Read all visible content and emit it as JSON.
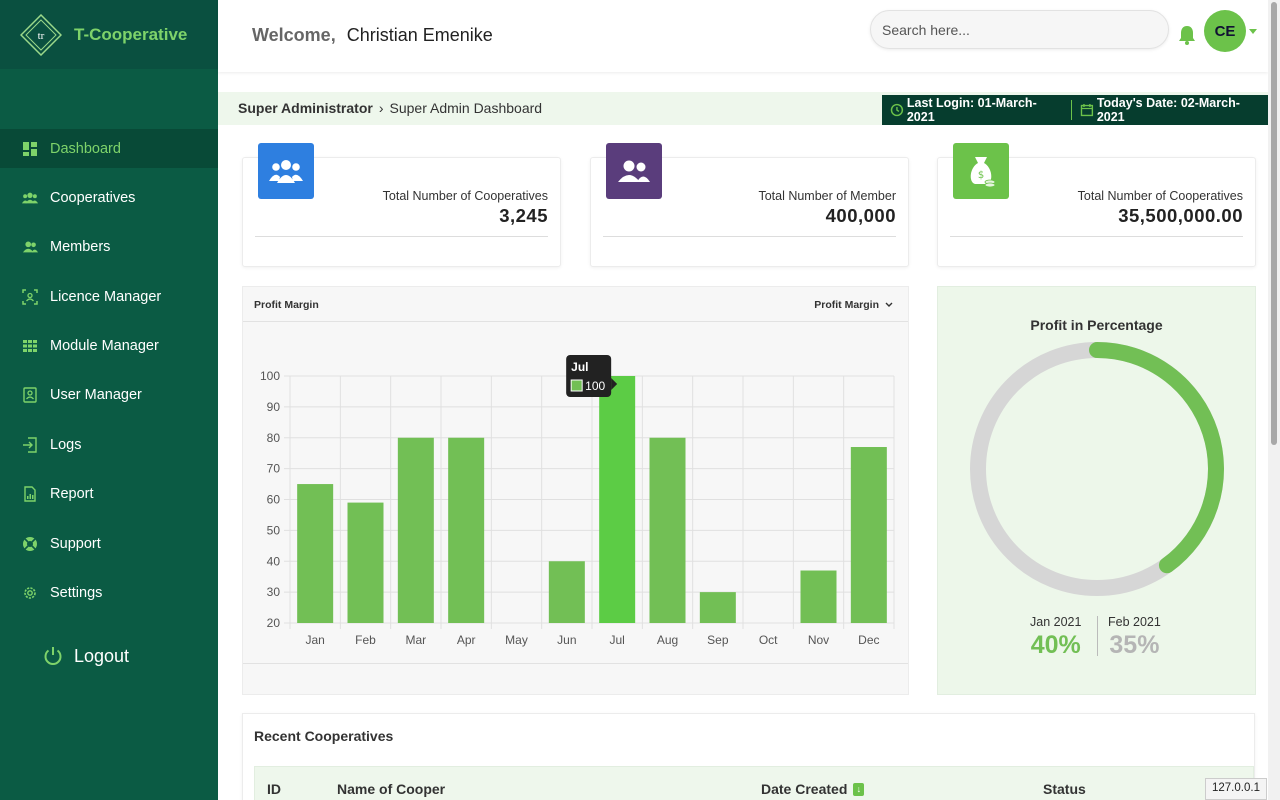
{
  "brand": {
    "name": "T-Cooperative",
    "logo_text": "tr"
  },
  "sidebar": {
    "items": [
      {
        "label": "Dashboard",
        "icon": "dashboard-icon",
        "active": true
      },
      {
        "label": "Cooperatives",
        "icon": "users-group-icon"
      },
      {
        "label": "Members",
        "icon": "members-icon"
      },
      {
        "label": "Licence Manager",
        "icon": "licence-icon"
      },
      {
        "label": "Module Manager",
        "icon": "grid-icon"
      },
      {
        "label": "User Manager",
        "icon": "user-badge-icon"
      },
      {
        "label": "Logs",
        "icon": "sign-in-icon"
      },
      {
        "label": "Report",
        "icon": "report-icon"
      },
      {
        "label": "Support",
        "icon": "lifebuoy-icon"
      },
      {
        "label": "Settings",
        "icon": "gear-icon"
      }
    ],
    "logout_label": "Logout"
  },
  "header": {
    "welcome_label": "Welcome,",
    "user_name": "Christian Emenike",
    "search_placeholder": "Search here...",
    "avatar_initials": "CE"
  },
  "breadcrumb": {
    "root": "Super Administrator",
    "current": "Super Admin Dashboard"
  },
  "dates": {
    "last_login": "Last Login: 01-March-2021",
    "today": "Today's Date: 02-March-2021"
  },
  "stats": [
    {
      "label": "Total Number of Cooperatives",
      "value": "3,245",
      "icon": "users-group-icon",
      "color": "#2e7fe0"
    },
    {
      "label": "Total Number of Member",
      "value": "400,000",
      "icon": "members-icon",
      "color": "#5a3d7c"
    },
    {
      "label": "Total Number of Cooperatives",
      "value": "35,500,000.00",
      "icon": "money-bag-icon",
      "color": "#6cc24a"
    }
  ],
  "profit_chart": {
    "title": "Profit Margin",
    "dropdown_label": "Profit Margin",
    "tooltip_month": "Jul",
    "tooltip_value": "100"
  },
  "chart_data": {
    "type": "bar",
    "categories": [
      "Jan",
      "Feb",
      "Mar",
      "Apr",
      "May",
      "Jun",
      "Jul",
      "Aug",
      "Sep",
      "Oct",
      "Nov",
      "Dec"
    ],
    "values": [
      65,
      59,
      80,
      80,
      null,
      40,
      100,
      80,
      30,
      null,
      37,
      77
    ],
    "ylim": [
      20,
      100
    ],
    "yticks": [
      20,
      30,
      40,
      50,
      60,
      70,
      80,
      90,
      100
    ],
    "grid": true,
    "highlight_index": 6,
    "colors": {
      "bar": "#72bf55",
      "highlight": "#5ccc45"
    }
  },
  "donut": {
    "title": "Profit in Percentage",
    "progress": 0.4,
    "series_a_label": "Jan 2021",
    "series_a_value": "40%",
    "series_b_label": "Feb 2021",
    "series_b_value": "35%",
    "colors": {
      "fill": "#72bf55",
      "track": "#d6d6d6",
      "b_value": "#b5b5b5"
    }
  },
  "recent": {
    "title": "Recent Cooperatives",
    "columns": [
      "ID",
      "Name of Cooper",
      "Date Created",
      "Status"
    ]
  },
  "statusbar": {
    "host": "127.0.0.1"
  },
  "colors": {
    "sidebar": "#0b5b44",
    "accent": "#6cc24a"
  }
}
